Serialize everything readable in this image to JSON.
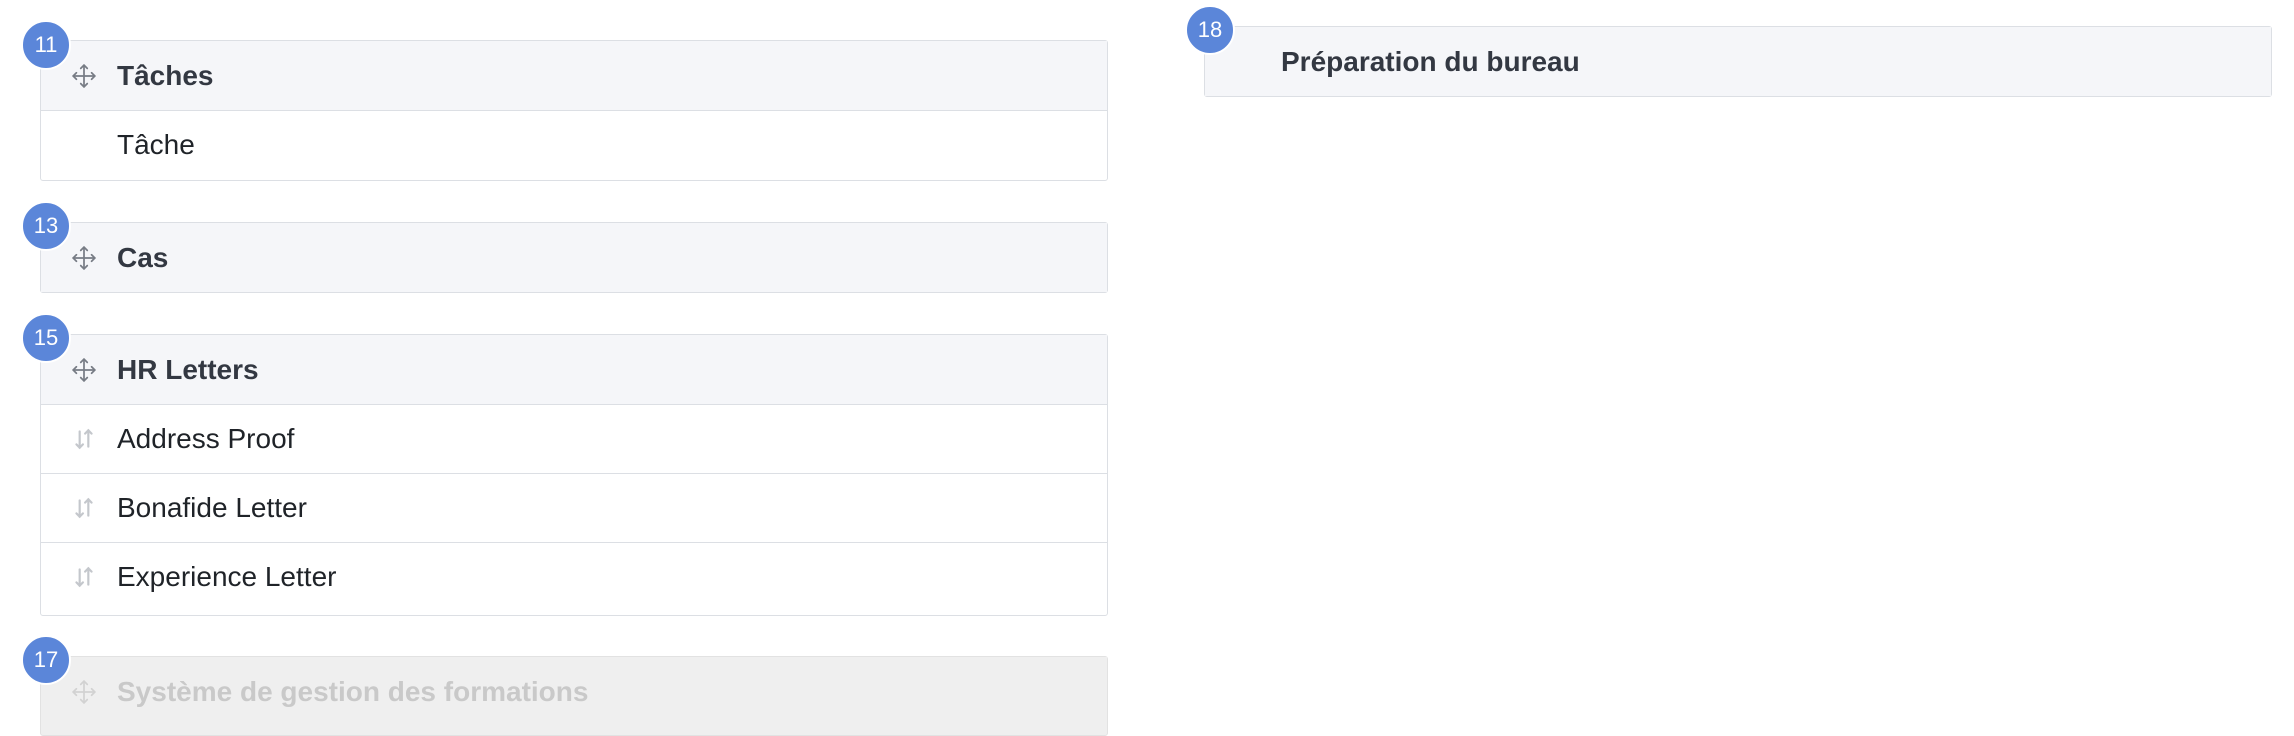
{
  "left_groups": [
    {
      "badge": "11",
      "title": "Tâches",
      "items": [
        "Tâche"
      ]
    },
    {
      "badge": "13",
      "title": "Cas",
      "items": []
    },
    {
      "badge": "15",
      "title": "HR Letters",
      "items": [
        "Address Proof",
        "Bonafide Letter",
        "Experience Letter"
      ]
    },
    {
      "badge": "17",
      "title": "Système de gestion des formations",
      "items": []
    }
  ],
  "right_groups": [
    {
      "badge": "18",
      "title": "Préparation du bureau"
    }
  ],
  "icons": {
    "group_handle": "move-icon",
    "item_handle": "sort-arrows-icon"
  },
  "colors": {
    "badge": "#5b86d9",
    "header_bg": "#f5f6f9",
    "disabled_bg": "#efefef",
    "border": "#dcdfe4"
  }
}
